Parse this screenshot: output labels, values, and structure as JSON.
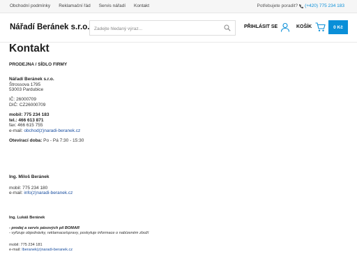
{
  "topbar": {
    "links": [
      "Obchodní podmínky",
      "Reklamační řád",
      "Servis nářadí",
      "Kontakt"
    ],
    "help_text": "Potřebujete poradit?",
    "phone": "(+420) 775 234 183"
  },
  "header": {
    "logo": "Nářadí Beránek s.r.o.",
    "search_placeholder": "Zadejte hledaný výraz...",
    "login": "PŘIHLÁSIT SE",
    "cart_label": "KOŠÍK",
    "cart_total": "0 Kč"
  },
  "content": {
    "title": "Kontakt",
    "subheading": "PRODEJNA / SÍDLO FIRMY",
    "company": {
      "name": "Nářadí Beránek s.r.o.",
      "street": "Štrossova 1795",
      "city": "53003 Pardubice",
      "ic": "IČ: 26000709",
      "dic": "DIČ: CZ26000709",
      "mobile": "mobil: 775 234 183",
      "tel": "tel.: 466 613 871",
      "fax": "fax: 466 615 755",
      "email_label": "e-mail: ",
      "email": "obchod(z)naradi-beranek.cz",
      "hours_label": "Otevírací doba:",
      "hours": " Po - Pá  7:30 - 15:30"
    },
    "person1": {
      "name": "Ing. Miloš Beránek",
      "mobile": "mobil: 775 234 180",
      "email_label": "e-mail: ",
      "email": "info(z)naradi-beranek.cz"
    },
    "person2": {
      "name": "Ing. Lukáš Beránek",
      "role": "- prodej a servis pásových pil BOMAR",
      "duties": "- vyřizuje objednávky, reklamace/opravy, poskytuje informace o nabízeném zboží",
      "mobile": "mobil: 775 234 181",
      "email_label": "e-mail: ",
      "email": "lberanek(z)naradi-beranek.cz"
    }
  }
}
